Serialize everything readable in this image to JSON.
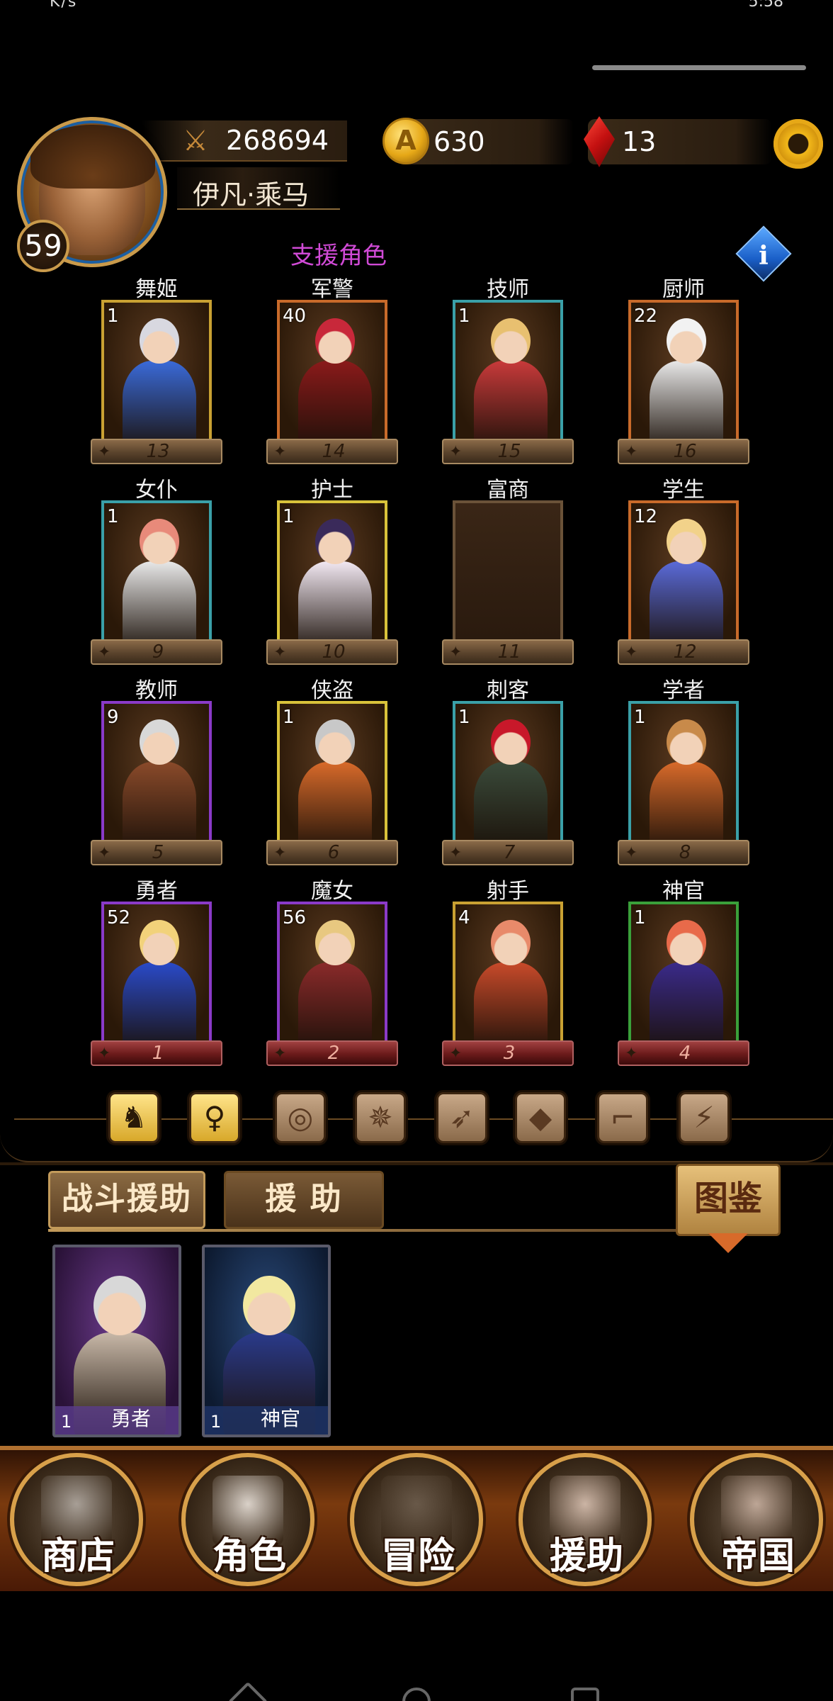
{
  "status_bar": {
    "left": "K/s",
    "right": "5:58"
  },
  "player": {
    "power": "268694",
    "name": "伊凡·乘马",
    "level": "59"
  },
  "currency": {
    "gold": "630",
    "gems": "13"
  },
  "support_title": "支援角色",
  "info_label": "i",
  "grid": [
    {
      "name": "舞姬",
      "level": "1",
      "num": "13",
      "frame": "gold",
      "plate": "normal",
      "hair": "#d8d8e0",
      "outfit": "#3a6ad8"
    },
    {
      "name": "军警",
      "level": "40",
      "num": "14",
      "frame": "orange",
      "plate": "normal",
      "hair": "#c8283a",
      "outfit": "#8a1a1a"
    },
    {
      "name": "技师",
      "level": "1",
      "num": "15",
      "frame": "teal",
      "plate": "normal",
      "hair": "#e8c070",
      "outfit": "#c83a3a"
    },
    {
      "name": "厨师",
      "level": "22",
      "num": "16",
      "frame": "orange",
      "plate": "normal",
      "hair": "#f2f2f2",
      "outfit": "#e8e8e8"
    },
    {
      "name": "女仆",
      "level": "1",
      "num": "9",
      "frame": "teal",
      "plate": "normal",
      "hair": "#e88a7a",
      "outfit": "#e8e8e8"
    },
    {
      "name": "护士",
      "level": "1",
      "num": "10",
      "frame": "yellow",
      "plate": "normal",
      "hair": "#3a2a5a",
      "outfit": "#f2e8f2"
    },
    {
      "name": "富商",
      "level": "",
      "num": "11",
      "frame": "empty",
      "plate": "normal",
      "hair": "",
      "outfit": ""
    },
    {
      "name": "学生",
      "level": "12",
      "num": "12",
      "frame": "orange",
      "plate": "normal",
      "hair": "#f2d28a",
      "outfit": "#5a6ad8"
    },
    {
      "name": "教师",
      "level": "9",
      "num": "5",
      "frame": "purple",
      "plate": "normal",
      "hair": "#d8d8d8",
      "outfit": "#8a4a2a"
    },
    {
      "name": "侠盗",
      "level": "1",
      "num": "6",
      "frame": "yellow",
      "plate": "normal",
      "hair": "#c8c8c8",
      "outfit": "#d86a2a"
    },
    {
      "name": "刺客",
      "level": "1",
      "num": "7",
      "frame": "teal",
      "plate": "normal",
      "hair": "#c8182a",
      "outfit": "#3a4a3a"
    },
    {
      "name": "学者",
      "level": "1",
      "num": "8",
      "frame": "teal",
      "plate": "normal",
      "hair": "#c88a4a",
      "outfit": "#d86a2a"
    },
    {
      "name": "勇者",
      "level": "52",
      "num": "1",
      "frame": "purple",
      "plate": "red",
      "hair": "#f2d27a",
      "outfit": "#2a4ac8"
    },
    {
      "name": "魔女",
      "level": "56",
      "num": "2",
      "frame": "purple",
      "plate": "red",
      "hair": "#e8c880",
      "outfit": "#8a2a2a"
    },
    {
      "name": "射手",
      "level": "4",
      "num": "3",
      "frame": "gold",
      "plate": "red",
      "hair": "#e88a6a",
      "outfit": "#c84a2a"
    },
    {
      "name": "神官",
      "level": "1",
      "num": "4",
      "frame": "green",
      "plate": "red",
      "hair": "#e86a4a",
      "outfit": "#3a2a8a"
    }
  ],
  "filters": [
    {
      "name": "beast-filter",
      "glyph": "♞",
      "active": true
    },
    {
      "name": "silhouette-filter",
      "glyph": "♀",
      "active": true
    },
    {
      "name": "target-filter",
      "glyph": "◎",
      "active": false
    },
    {
      "name": "wheel-filter",
      "glyph": "✵",
      "active": false
    },
    {
      "name": "bow-filter",
      "glyph": "➶",
      "active": false
    },
    {
      "name": "diamond-filter",
      "glyph": "◆",
      "active": false
    },
    {
      "name": "boot-filter",
      "glyph": "⌐",
      "active": false
    },
    {
      "name": "claw-filter",
      "glyph": "⚡",
      "active": false
    }
  ],
  "tabs": {
    "battle_assist": "战斗援助",
    "assist": "援 助",
    "album": "图鉴"
  },
  "assist_cards": [
    {
      "level": "1",
      "name": "勇者",
      "hair": "#d8d8d8",
      "outfit": "#c8b8a8"
    },
    {
      "level": "1",
      "name": "神官",
      "hair": "#f2e8a0",
      "outfit": "#2a3a8a"
    }
  ],
  "nav": [
    {
      "label": "商店",
      "icon": "castle-icon",
      "tone": "#b0a8a0"
    },
    {
      "label": "角色",
      "icon": "hood-icon",
      "tone": "#e8e0d8"
    },
    {
      "label": "冒险",
      "icon": "gate-icon",
      "tone": "#6a5a4a"
    },
    {
      "label": "援助",
      "icon": "girl-icon",
      "tone": "#d8c0b0"
    },
    {
      "label": "帝国",
      "icon": "crown-icon",
      "tone": "#c8b0a0"
    }
  ]
}
